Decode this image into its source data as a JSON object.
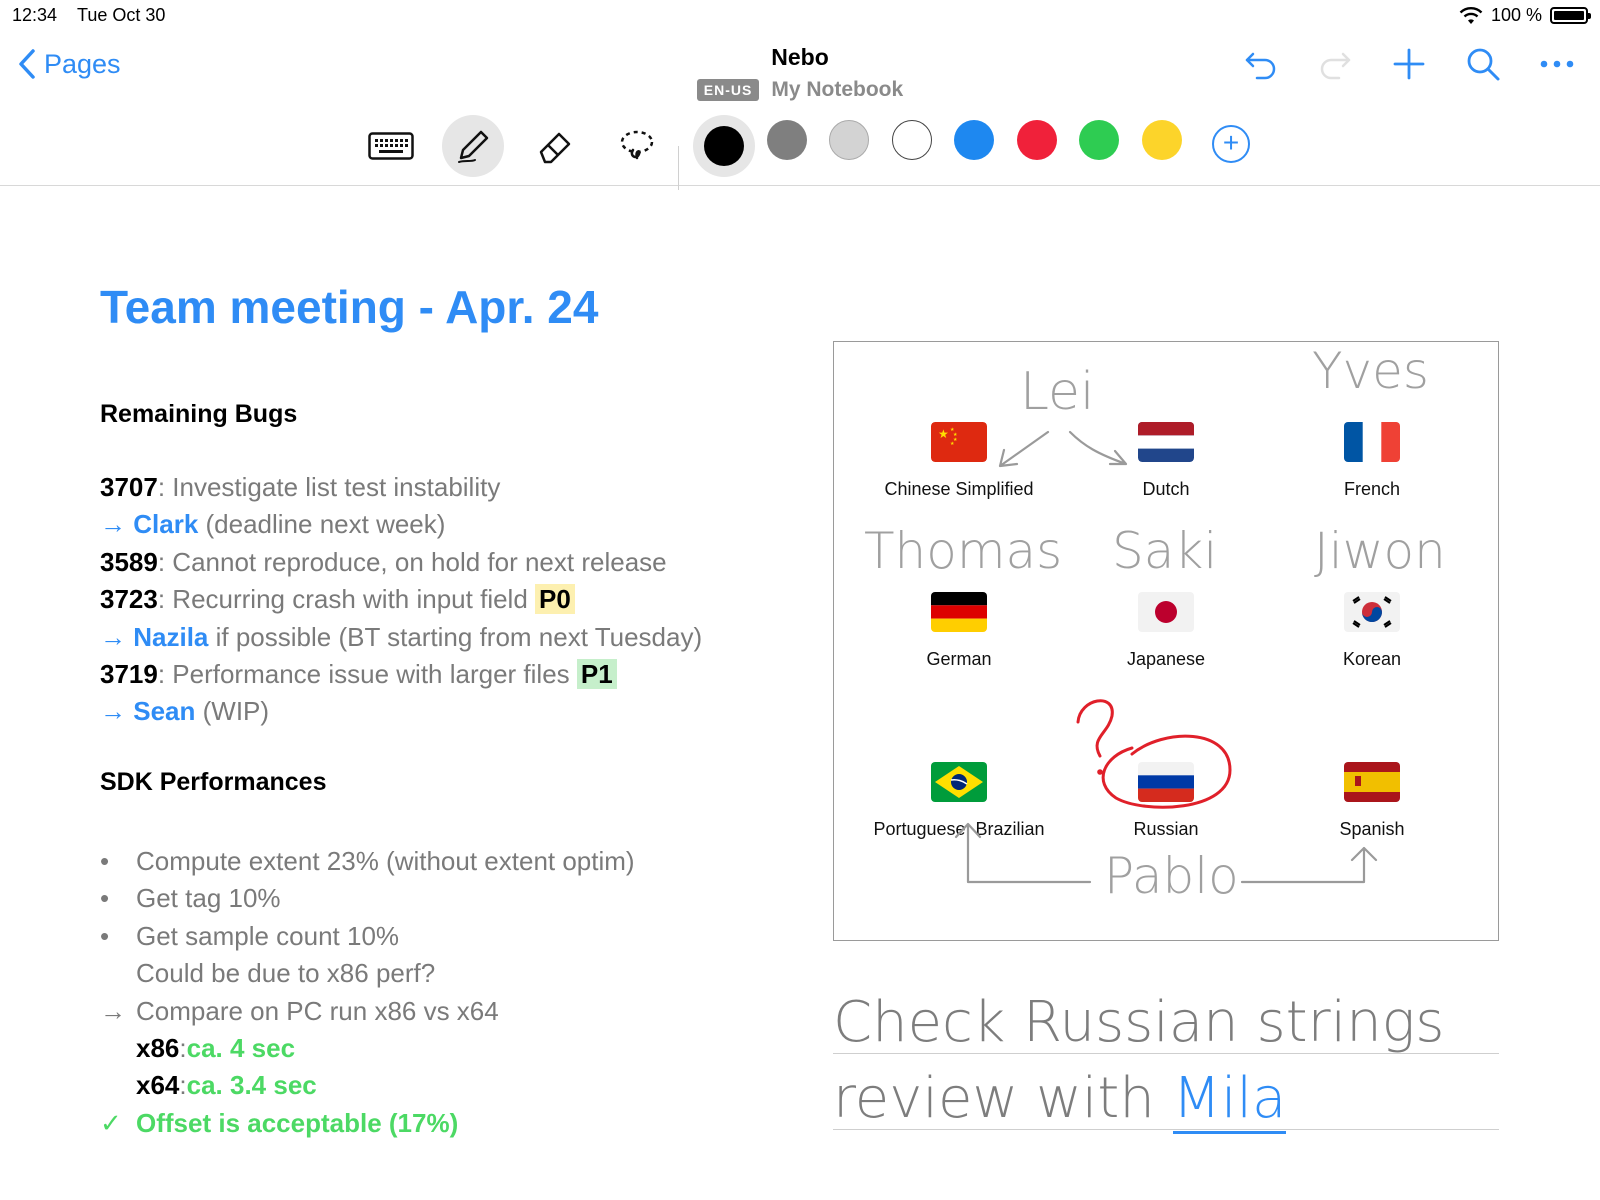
{
  "status": {
    "time": "12:34",
    "date": "Tue Oct 30",
    "battery": "100 %",
    "battery_level": 1.0
  },
  "nav": {
    "back_label": "Pages",
    "app_title": "Nebo",
    "language_badge": "EN-US",
    "notebook_name": "My Notebook",
    "actions": [
      "undo-icon",
      "redo-icon",
      "plus-icon",
      "search-icon",
      "more-icon"
    ]
  },
  "toolbar": {
    "tools": [
      "keyboard-icon",
      "pen-icon",
      "eraser-icon",
      "lasso-icon"
    ],
    "active_tool": "pen-icon",
    "colors": [
      "#000000",
      "#7f7f7f",
      "#d3d3d3",
      "#ffffff",
      "#1e88f0",
      "#f0213a",
      "#2ecc52",
      "#fcd42a"
    ],
    "selected_color": "#000000",
    "add_color": "+"
  },
  "page": {
    "title": "Team meeting - Apr. 24",
    "bugs_heading": "Remaining Bugs",
    "bugs": [
      {
        "num": "3707",
        "text": ": Investigate list test instability",
        "tag": ""
      },
      {
        "arrow": "→",
        "name": "Clark",
        "text": " (deadline next week)"
      },
      {
        "num": "3589",
        "text": ": Cannot reproduce, on hold for next release",
        "tag": ""
      },
      {
        "num": "3723",
        "text": ": Recurring crash with input field ",
        "tag": "P0"
      },
      {
        "arrow": "→",
        "name": "Nazila",
        "text": " if possible (BT starting from next Tuesday)"
      },
      {
        "num": "3719",
        "text": ": Performance issue with larger files ",
        "tag": "P1"
      },
      {
        "arrow": "→",
        "name": "Sean",
        "text": " (WIP)"
      }
    ],
    "sdk_heading": "SDK Performances",
    "sdk": {
      "bullets": [
        "Compute extent 23% (without extent optim)",
        "Get tag 10%",
        "Get sample count 10%"
      ],
      "note": "Could be due to x86 perf?",
      "compare_arrow": "→",
      "compare": "Compare on PC run x86 vs x64",
      "x86_label": "x86",
      "x86_value": "ca. 4 sec",
      "x64_label": "x64",
      "x64_value": "ca. 3.4 sec",
      "check": "✓",
      "result": "Offset is acceptable (17%)"
    }
  },
  "diagram": {
    "languages": [
      "Chinese Simplified",
      "Dutch",
      "French",
      "German",
      "Japanese",
      "Korean",
      "Portuguese, Brazilian",
      "Russian",
      "Spanish"
    ],
    "handwritten_names": [
      "Lei",
      "Yves",
      "Thomas",
      "Saki",
      "Jiwon",
      "Pablo"
    ],
    "question_mark": "?"
  },
  "handwriting": {
    "line1": "Check Russian strings",
    "line2_prefix": "review with",
    "line2_name": "Mila"
  }
}
